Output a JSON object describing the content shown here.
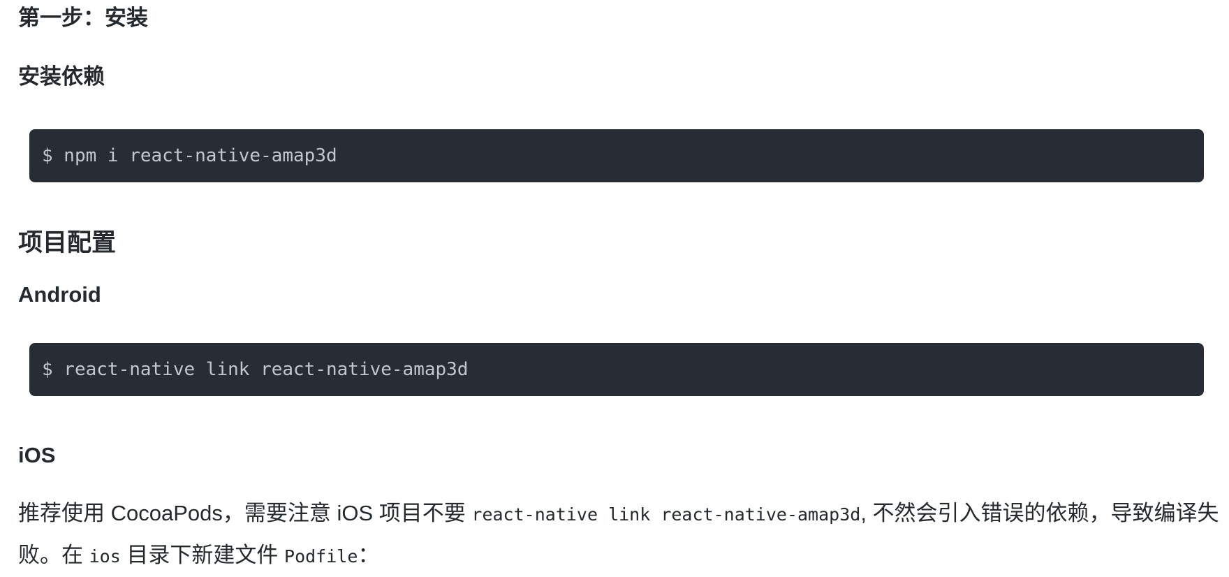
{
  "headings": {
    "step1": "第一步：安装",
    "install_deps": "安装依赖",
    "project_config": "项目配置",
    "android": "Android",
    "ios": "iOS"
  },
  "code_blocks": {
    "install": "$ npm i react-native-amap3d",
    "android_link": "$ react-native link react-native-amap3d"
  },
  "ios_paragraph": {
    "part1": "推荐使用 CocoaPods，需要注意 iOS 项目不要 ",
    "code1": "react-native link react-native-amap3d",
    "part2": ", 不然会引入错误的依赖，导致编译失败。在 ",
    "code2": "ios",
    "part3": " 目录下新建文件 ",
    "code3": "Podfile",
    "part4": "："
  }
}
